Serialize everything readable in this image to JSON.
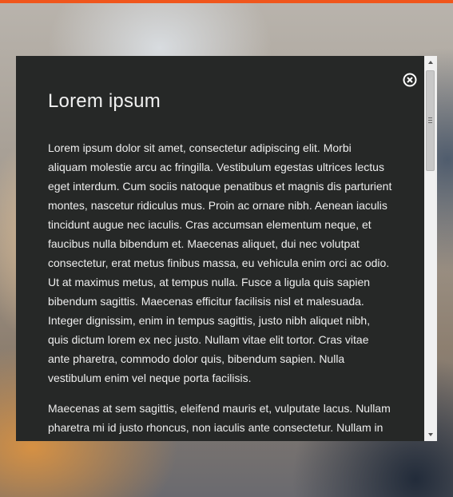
{
  "modal": {
    "title": "Lorem ipsum",
    "paragraphs": [
      "Lorem ipsum dolor sit amet, consectetur adipiscing elit. Morbi aliquam molestie arcu ac fringilla. Vestibulum egestas ultrices lectus eget interdum. Cum sociis natoque penatibus et magnis dis parturient montes, nascetur ridiculus mus. Proin ac ornare nibh. Aenean iaculis tincidunt augue nec iaculis. Cras accumsan elementum neque, et faucibus nulla bibendum et. Maecenas aliquet, dui nec volutpat consectetur, erat metus finibus massa, eu vehicula enim orci ac odio. Ut at maximus metus, at tempus nulla. Fusce a ligula quis sapien bibendum sagittis. Maecenas efficitur facilisis nisl et malesuada. Integer dignissim, enim in tempus sagittis, justo nibh aliquet nibh, quis dictum lorem ex nec justo. Nullam vitae elit tortor. Cras vitae ante pharetra, commodo dolor quis, bibendum sapien. Nulla vestibulum enim vel neque porta facilisis.",
      "Maecenas at sem sagittis, eleifend mauris et, vulputate lacus. Nullam pharetra mi id justo rhoncus, non iaculis ante consectetur. Nullam in malesuada ex, quis vestibulum tortor. Nam ut nisl sem."
    ],
    "close_icon": "close-circle-icon"
  },
  "colors": {
    "accent_bar": "#f0561c",
    "modal_background": "#262827",
    "text": "#ededed"
  }
}
